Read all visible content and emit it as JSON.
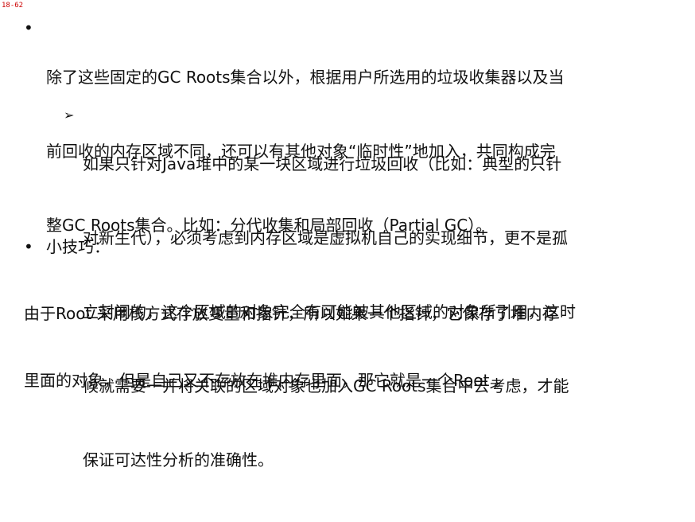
{
  "slide_number": "18-62",
  "bullet1": {
    "lines": [
      "除了这些固定的GC Roots集合以外，根据用户所选用的垃圾收集器以及当",
      "前回收的内存区域不同，还可以有其他对象“临时性”地加入，共同构成完",
      "整GC Roots集合。比如：分代收集和局部回收（Partial GC）。"
    ]
  },
  "sub_bullet": {
    "lines": [
      "如果只针对Java堆中的某一块区域进行垃圾回收（比如：典型的只针",
      "对新生代），必须考虑到内存区域是虚拟机自己的实现细节，更不是孤",
      "立封闭的，这个区域的对象完全有可能被其他区域的对象所引用，这时",
      "候就需要一并将关联的区域对象也加入GC Roots集合中去考虑，才能",
      "保证可达性分析的准确性。"
    ]
  },
  "bullet2": {
    "title": "小技巧："
  },
  "tip": {
    "lines": [
      "由于Root 采用栈方式存放变量和指针，所以如果一个指针，它保存了堆内存",
      "里面的对象，但是自己又不存放在堆内存里面，那它就是一个Root 。"
    ]
  },
  "symbols": {
    "bullet": "•",
    "arrow": "➢"
  }
}
